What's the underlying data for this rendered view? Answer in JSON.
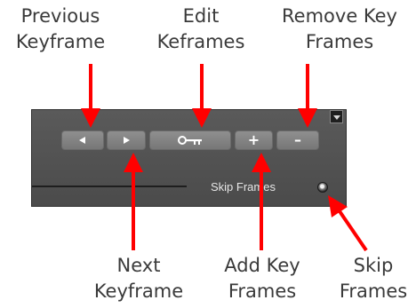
{
  "callouts": {
    "previous_keyframe": [
      "Previous",
      "Keyframe"
    ],
    "edit_keyframes": [
      "Edit",
      "Keframes"
    ],
    "remove_key_frames": [
      "Remove Key",
      "Frames"
    ],
    "next_keyframe": [
      "Next",
      "Keyframe"
    ],
    "add_key_frames": [
      "Add Key",
      "Frames"
    ],
    "skip_frames": [
      "Skip",
      "Frames"
    ]
  },
  "panel": {
    "skip_frames_label": "Skip Frames",
    "buttons": {
      "previous_icon": "triangle-left-icon",
      "next_icon": "triangle-right-icon",
      "edit_icon": "key-icon",
      "add_label": "+",
      "remove_label": "–"
    },
    "colors": {
      "panel_bg": "#535353",
      "button_bg": "#848484",
      "annotation_arrow": "#ff0000"
    }
  }
}
